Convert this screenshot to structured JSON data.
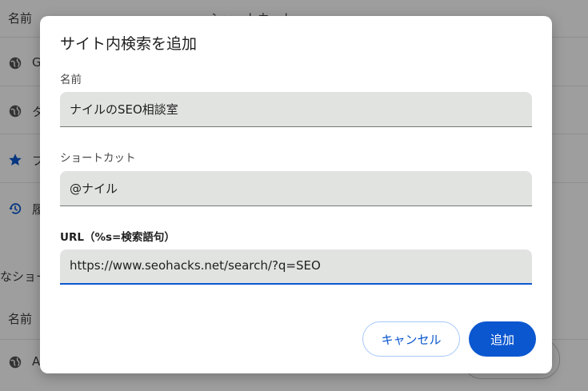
{
  "background": {
    "header_name": "名前",
    "header_shortcut": "ショートカット",
    "rows": [
      {
        "label": "G",
        "icon": "globe-icon"
      },
      {
        "label": "タ",
        "icon": "globe-icon"
      },
      {
        "label": "ブ",
        "icon": "star-icon"
      },
      {
        "label": "履",
        "icon": "history-icon"
      }
    ],
    "section_title": "なショー",
    "section_header_name": "名前",
    "section_rows": [
      {
        "label": "A",
        "icon": "globe-icon"
      }
    ]
  },
  "dialog": {
    "title": "サイト内検索を追加",
    "name_label": "名前",
    "name_value": "ナイルのSEO相談室",
    "shortcut_label": "ショートカット",
    "shortcut_value": "@ナイル",
    "url_label": "URL（%s=検索語句）",
    "url_value": "https://www.seohacks.net/search/?q=SEO",
    "cancel_label": "キャンセル",
    "add_label": "追加"
  },
  "colors": {
    "accent": "#0b57d0",
    "field_bg": "#e1e3e1",
    "scrim": "rgba(0,0,0,0.38)"
  }
}
